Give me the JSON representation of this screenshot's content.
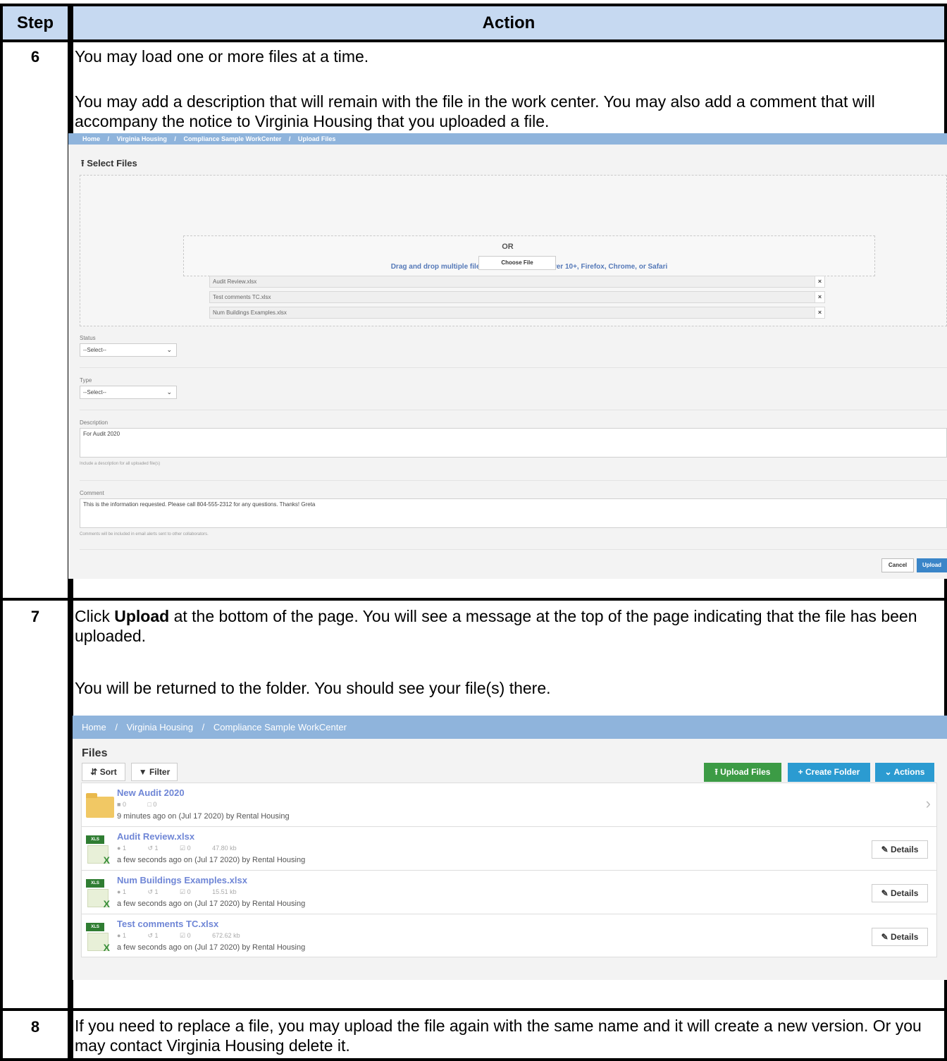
{
  "table": {
    "header_step": "Step",
    "header_action": "Action",
    "steps": [
      {
        "number": "6",
        "paragraphs": [
          "You may load one or more files at a time.",
          "You may add a description that will remain with the file in the work center. You may also add a comment that will accompany the notice to Virginia Housing that you uploaded a file."
        ]
      },
      {
        "number": "7",
        "p1_before": "Click ",
        "p1_bold": "Upload",
        "p1_after": " at the bottom of the page. You will see a message at the top of the page indicating that the file has been uploaded.",
        "p2": "You will be returned to the folder. You should see your file(s) there."
      },
      {
        "number": "8",
        "paragraphs": [
          "If you need to replace a file, you may upload the file again with the same name and it will create a new version. Or you may contact Virginia Housing delete it."
        ]
      }
    ]
  },
  "upload_screen": {
    "breadcrumb": [
      "Home",
      "/",
      "Virginia Housing",
      "/",
      "Compliance Sample WorkCenter",
      "/",
      "Upload Files"
    ],
    "title": "Select Files",
    "drop_text": "Drag and drop multiple files using Internet Explorer 10+, Firefox, Chrome, or Safari",
    "or_text": "OR",
    "choose_file": "Choose File",
    "files": [
      "Audit Review.xlsx",
      "Test comments TC.xlsx",
      "Num Buildings Examples.xlsx"
    ],
    "remove_glyph": "×",
    "status_label": "Status",
    "status_value": "--Select--",
    "type_label": "Type",
    "type_value": "--Select--",
    "description_label": "Description",
    "description_value": "For Audit 2020",
    "description_help": "Include a description for all uploaded file(s)",
    "comment_label": "Comment",
    "comment_value": "This is the information requested.  Please call 804-555-2312 for any questions.  Thanks!  Greta",
    "comment_help": "Comments will be included in email alerts sent to other collaborators.",
    "cancel": "Cancel",
    "upload": "Upload"
  },
  "files_screen": {
    "breadcrumb": [
      "Home",
      "/",
      "Virginia Housing",
      "/",
      "Compliance Sample WorkCenter"
    ],
    "title": "Files",
    "sort": "Sort",
    "filter": "Filter",
    "upload_files": "Upload Files",
    "create_folder": "+ Create Folder",
    "actions": "Actions",
    "details": "Details",
    "xls_tag": "XLS",
    "items": [
      {
        "name": "New Audit 2020",
        "meta": [
          "0",
          "0"
        ],
        "by": "9 minutes ago on (Jul 17 2020) by Rental Housing"
      },
      {
        "name": "Audit Review.xlsx",
        "meta": [
          "1",
          "1",
          "0",
          "47.80 kb"
        ],
        "by": "a few seconds ago on (Jul 17 2020) by Rental Housing"
      },
      {
        "name": "Num Buildings Examples.xlsx",
        "meta": [
          "1",
          "1",
          "0",
          "15.51 kb"
        ],
        "by": "a few seconds ago on (Jul 17 2020) by Rental Housing"
      },
      {
        "name": "Test comments TC.xlsx",
        "meta": [
          "1",
          "1",
          "0",
          "672.62 kb"
        ],
        "by": "a few seconds ago on (Jul 17 2020) by Rental Housing"
      }
    ]
  },
  "colors": {
    "header_fill": "#c6d9f1",
    "breadcrumb_bar": "#8fb4dc",
    "upload_green": "#3c9b45",
    "action_blue": "#2b9bd1",
    "link_purple": "#6f86d6"
  }
}
